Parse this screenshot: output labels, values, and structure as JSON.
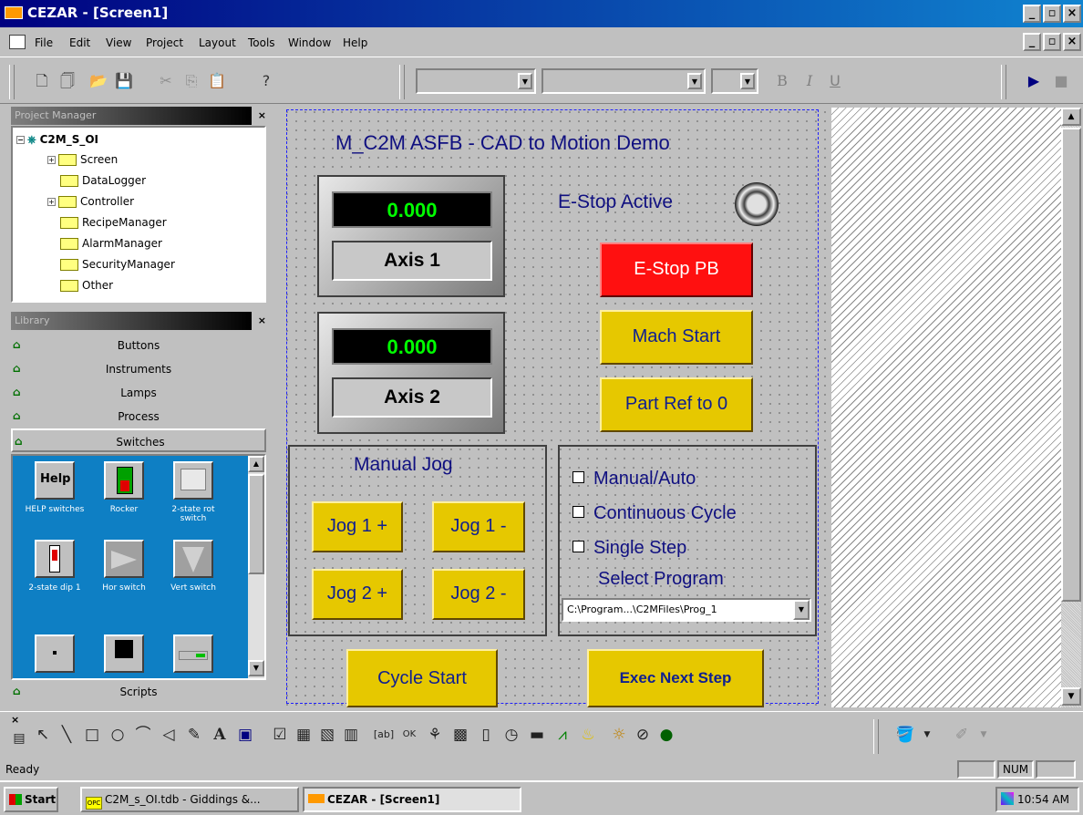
{
  "window": {
    "title": "CEZAR - [Screen1]"
  },
  "menu": [
    "File",
    "Edit",
    "View",
    "Project",
    "Layout",
    "Tools",
    "Window",
    "Help"
  ],
  "toolbar": {
    "font_bold": "B",
    "font_italic": "I",
    "font_underline": "U"
  },
  "project_manager": {
    "title": "Project Manager",
    "root": "C2M_S_OI",
    "items": [
      "Screen",
      "DataLogger",
      "Controller",
      "RecipeManager",
      "AlarmManager",
      "SecurityManager",
      "Other"
    ]
  },
  "library": {
    "title": "Library",
    "categories": [
      "Buttons",
      "Instruments",
      "Lamps",
      "Process",
      "Switches"
    ],
    "palette": [
      {
        "label": "HELP switches",
        "icon_text": "Help"
      },
      {
        "label": "Rocker"
      },
      {
        "label": "2-state rot switch"
      },
      {
        "label": "2-state dip 1"
      },
      {
        "label": "Hor switch"
      },
      {
        "label": "Vert switch"
      }
    ],
    "scripts": "Scripts"
  },
  "hmi": {
    "title": "M_C2M ASFB - CAD to Motion Demo",
    "axis1": {
      "value": "0.000",
      "label": "Axis 1"
    },
    "axis2": {
      "value": "0.000",
      "label": "Axis 2"
    },
    "estop_active": "E-Stop Active",
    "estop_pb": "E-Stop PB",
    "mach_start": "Mach Start",
    "part_ref": "Part Ref to 0",
    "manual_jog": "Manual Jog",
    "jog1_plus": "Jog 1 +",
    "jog1_minus": "Jog 1 -",
    "jog2_plus": "Jog 2 +",
    "jog2_minus": "Jog 2 -",
    "manual_auto": "Manual/Auto",
    "continuous_cycle": "Continuous Cycle",
    "single_step": "Single Step",
    "select_program": "Select Program",
    "program_path": "C:\\Program...\\C2MFiles\\Prog_1",
    "cycle_start": "Cycle Start",
    "exec_next_step": "Exec Next Step",
    "colors": {
      "yellow_button": "#e6c800",
      "red_button": "#ff1010",
      "display_text": "#00ff00",
      "label_text": "#101080"
    }
  },
  "status": {
    "text": "Ready",
    "num": "NUM"
  },
  "taskbar": {
    "start": "Start",
    "task1": "C2M_s_OI.tdb - Giddings &...",
    "task2": "CEZAR - [Screen1]",
    "clock": "10:54 AM"
  }
}
